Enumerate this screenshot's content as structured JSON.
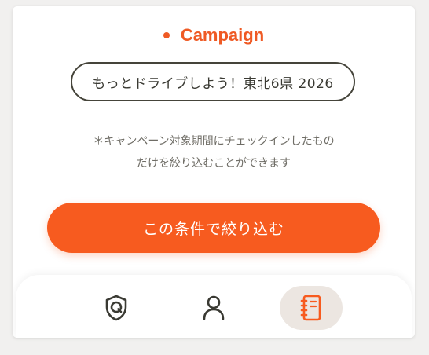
{
  "section": {
    "title": "Campaign"
  },
  "filter_chip": {
    "label": "もっとドライブしよう！東北6県 2026"
  },
  "note": {
    "line1": "＊キャンペーン対象期間にチェックインしたもの",
    "line2": "だけを絞り込むことができます"
  },
  "actions": {
    "apply_label": "この条件で絞り込む"
  },
  "bottom_nav": {
    "items": [
      {
        "icon": "shield-q-icon",
        "active": false
      },
      {
        "icon": "person-icon",
        "active": false
      },
      {
        "icon": "notebook-icon",
        "active": true
      }
    ]
  },
  "colors": {
    "accent": "#ef5a24",
    "button": "#f75b1f",
    "chip_border": "#45443a",
    "nav_active_bg": "#ece6e1"
  }
}
